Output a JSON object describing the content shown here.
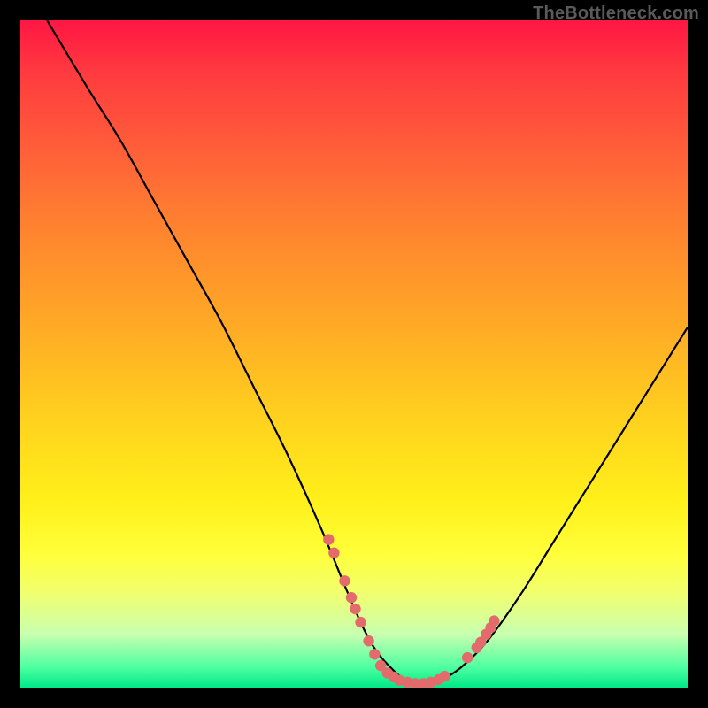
{
  "watermark": "TheBottleneck.com",
  "colors": {
    "dot": "#e36b6b",
    "curve": "#000000",
    "frame": "#000000"
  },
  "chart_data": {
    "type": "line",
    "title": "",
    "xlabel": "",
    "ylabel": "",
    "xlim": [
      0,
      100
    ],
    "ylim": [
      0,
      100
    ],
    "grid": false,
    "legend": false,
    "notes": "V-shaped curve over vertical red-to-green gradient; minimum region highlighted with dots near bottom. No axis tick labels visible.",
    "series": [
      {
        "name": "curve",
        "x": [
          4,
          10,
          15,
          20,
          25,
          30,
          35,
          40,
          45,
          50,
          53,
          56,
          58,
          60,
          63,
          66,
          70,
          75,
          80,
          85,
          90,
          95,
          100
        ],
        "y": [
          100,
          90,
          82,
          73,
          64,
          55,
          45,
          35,
          24,
          12,
          6,
          2.5,
          1,
          0.5,
          1.2,
          3,
          7,
          14,
          22,
          30,
          38,
          46,
          54
        ]
      }
    ],
    "highlight_dots": {
      "name": "dots",
      "points": [
        {
          "x": 46.2,
          "y": 22.2
        },
        {
          "x": 47.0,
          "y": 20.2
        },
        {
          "x": 48.6,
          "y": 16.0
        },
        {
          "x": 49.6,
          "y": 13.5
        },
        {
          "x": 50.2,
          "y": 11.8
        },
        {
          "x": 51.0,
          "y": 9.8
        },
        {
          "x": 52.2,
          "y": 7.0
        },
        {
          "x": 53.1,
          "y": 5.0
        },
        {
          "x": 54.0,
          "y": 3.3
        },
        {
          "x": 55.0,
          "y": 2.2
        },
        {
          "x": 55.9,
          "y": 1.6
        },
        {
          "x": 56.8,
          "y": 1.1
        },
        {
          "x": 58.0,
          "y": 0.8
        },
        {
          "x": 59.2,
          "y": 0.6
        },
        {
          "x": 60.4,
          "y": 0.6
        },
        {
          "x": 61.5,
          "y": 0.8
        },
        {
          "x": 62.7,
          "y": 1.2
        },
        {
          "x": 63.6,
          "y": 1.7
        },
        {
          "x": 67.0,
          "y": 4.5
        },
        {
          "x": 68.4,
          "y": 6.0
        },
        {
          "x": 69.0,
          "y": 6.8
        },
        {
          "x": 69.8,
          "y": 8.0
        },
        {
          "x": 70.5,
          "y": 9.0
        },
        {
          "x": 71.0,
          "y": 10.0
        }
      ]
    }
  }
}
